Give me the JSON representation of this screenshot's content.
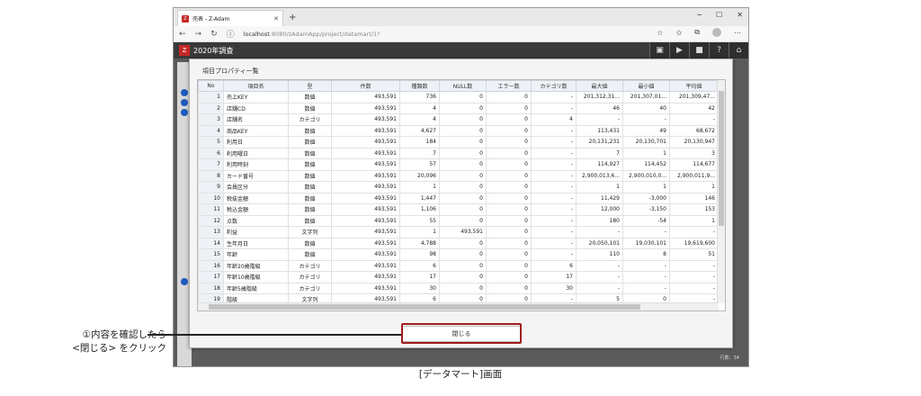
{
  "browser": {
    "tab_title": "売表 - Z-Adam",
    "favicon_text": "Z",
    "url_host": "localhost",
    "url_path": ":8080/zAdamApp/project/datamart/1?"
  },
  "app": {
    "title": "2020年調査",
    "row_count": "行数：34"
  },
  "dialog": {
    "title": "項目プロパティ一覧",
    "close_label": "閉じる",
    "columns": [
      "No",
      "項目名",
      "型",
      "件数",
      "種類数",
      "NULL数",
      "エラー数",
      "カテゴリ数",
      "最大値",
      "最小値",
      "平均値"
    ],
    "rows": [
      [
        "1",
        "売上KEY",
        "数値",
        "493,591",
        "736",
        "0",
        "0",
        "-",
        "201,312,31...",
        "201,307,01...",
        "201,309,47..."
      ],
      [
        "2",
        "店舗CD",
        "数値",
        "493,591",
        "4",
        "0",
        "0",
        "-",
        "46",
        "40",
        "42"
      ],
      [
        "3",
        "店舗名",
        "カテゴリ",
        "493,591",
        "4",
        "0",
        "0",
        "4",
        "-",
        "-",
        "-"
      ],
      [
        "4",
        "商品KEY",
        "数値",
        "493,591",
        "4,627",
        "0",
        "0",
        "-",
        "113,431",
        "49",
        "68,672"
      ],
      [
        "5",
        "利用日",
        "数値",
        "493,591",
        "184",
        "0",
        "0",
        "-",
        "20,131,231",
        "20,130,701",
        "20,130,947"
      ],
      [
        "6",
        "利用曜日",
        "数値",
        "493,591",
        "7",
        "0",
        "0",
        "-",
        "7",
        "1",
        "3"
      ],
      [
        "7",
        "利用時刻",
        "数値",
        "493,591",
        "57",
        "0",
        "0",
        "-",
        "114,927",
        "114,452",
        "114,677"
      ],
      [
        "8",
        "カード番号",
        "数値",
        "493,591",
        "20,096",
        "0",
        "0",
        "-",
        "2,900,013,6...",
        "2,900,010,0...",
        "2,900,011,9..."
      ],
      [
        "9",
        "会員区分",
        "数値",
        "493,591",
        "1",
        "0",
        "0",
        "-",
        "1",
        "1",
        "1"
      ],
      [
        "10",
        "税抜金額",
        "数値",
        "493,591",
        "1,447",
        "0",
        "0",
        "-",
        "11,429",
        "-3,000",
        "146"
      ],
      [
        "11",
        "税込金額",
        "数値",
        "493,591",
        "1,106",
        "0",
        "0",
        "-",
        "12,000",
        "-3,150",
        "153"
      ],
      [
        "12",
        "点数",
        "数値",
        "493,591",
        "55",
        "0",
        "0",
        "-",
        "180",
        "-54",
        "1"
      ],
      [
        "13",
        "利益",
        "文字列",
        "493,591",
        "1",
        "493,591",
        "0",
        "-",
        "-",
        "-",
        "-"
      ],
      [
        "14",
        "生年月日",
        "数値",
        "493,591",
        "4,788",
        "0",
        "0",
        "-",
        "20,050,101",
        "19,030,101",
        "19,619,600"
      ],
      [
        "15",
        "年齢",
        "数値",
        "493,591",
        "98",
        "0",
        "0",
        "-",
        "110",
        "8",
        "51"
      ],
      [
        "16",
        "年齢20歳階級",
        "カテゴリ",
        "493,591",
        "6",
        "0",
        "0",
        "6",
        "-",
        "-",
        "-"
      ],
      [
        "17",
        "年齢10歳階級",
        "カテゴリ",
        "493,591",
        "17",
        "0",
        "0",
        "17",
        "-",
        "-",
        "-"
      ],
      [
        "18",
        "年齢5歳階級",
        "カテゴリ",
        "493,591",
        "30",
        "0",
        "0",
        "30",
        "-",
        "-",
        "-"
      ],
      [
        "19",
        "階級",
        "文字列",
        "493,591",
        "6",
        "0",
        "0",
        "-",
        "5",
        "0",
        "-"
      ]
    ]
  },
  "annotation": {
    "line1": "①内容を確認したら",
    "line2": "<閉じる> をクリック",
    "caption": "[データマート]画面"
  },
  "colors": {
    "highlight": "#a21d1d",
    "app_bg": "#5b5b5b",
    "accent": "#c62828"
  }
}
